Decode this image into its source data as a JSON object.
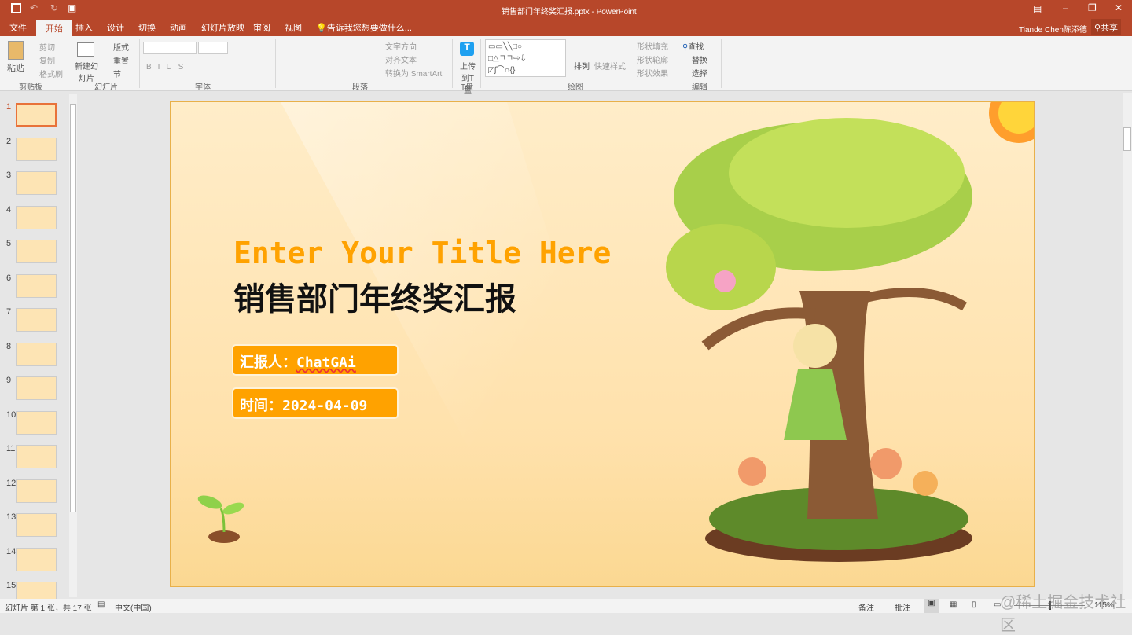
{
  "window": {
    "title": "销售部门年终奖汇报.pptx - PowerPoint",
    "user": "Tiande Chen陈添德",
    "share": "共享"
  },
  "tabs": [
    "文件",
    "开始",
    "插入",
    "设计",
    "切换",
    "动画",
    "幻灯片放映",
    "审阅",
    "视图"
  ],
  "tell_me": "告诉我您想要做什么...",
  "ribbon": {
    "clipboard": {
      "paste": "粘贴",
      "cut": "剪切",
      "copy": "复制",
      "format_painter": "格式刷",
      "label": "剪贴板"
    },
    "slides": {
      "new_slide": "新建幻灯片",
      "layout": "版式",
      "reset": "重置",
      "section": "节",
      "label": "幻灯片"
    },
    "font": {
      "label": "字体"
    },
    "paragraph": {
      "text_direction": "文字方向",
      "align_text": "对齐文本",
      "smartart": "转换为 SmartArt",
      "label": "段落"
    },
    "tdisk": {
      "upload": "上传到T盘",
      "label": "T盘"
    },
    "drawing": {
      "arrange": "排列",
      "quick_styles": "快速样式",
      "fill": "形状填充",
      "outline": "形状轮廓",
      "effects": "形状效果",
      "label": "绘图"
    },
    "editing": {
      "find": "查找",
      "replace": "替换",
      "select": "选择",
      "label": "编辑"
    }
  },
  "thumbnails": [
    "1",
    "2",
    "3",
    "4",
    "5",
    "6",
    "7",
    "8",
    "9",
    "10",
    "11",
    "12",
    "13",
    "14",
    "15"
  ],
  "slide": {
    "title_en": "Enter Your Title Here",
    "title_cn": "销售部门年终奖汇报",
    "reporter_label": "汇报人：",
    "reporter": "ChatGAi",
    "date_label": "时间：",
    "date": "2024-04-09",
    "accent": "#ffa200"
  },
  "status": {
    "slide_info": "幻灯片 第 1 张，共 17 张",
    "language": "中文(中国)",
    "notes": "备注",
    "comments": "批注",
    "zoom": "115%"
  },
  "watermark": "@稀土掘金技术社区"
}
